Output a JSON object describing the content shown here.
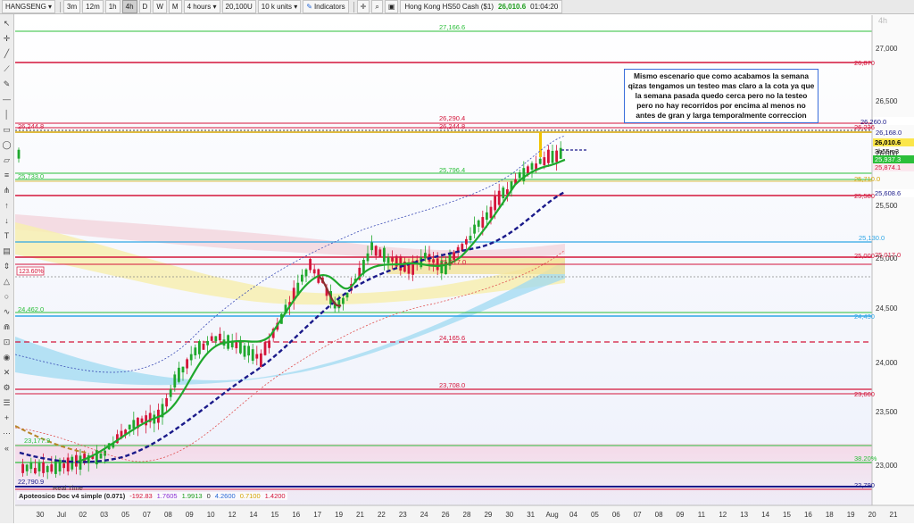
{
  "toolbar": {
    "symbol": "HANGSENG",
    "timeframes": [
      "3m",
      "12m",
      "1h",
      "4h",
      "D",
      "W",
      "M"
    ],
    "active_timeframe": "4h",
    "period": "4 hours",
    "units": "20,100U",
    "size": "10 k units",
    "indicators_label": "Indicators",
    "instrument_name": "Hong Kong HS50 Cash ($1)",
    "instrument_price": "26,010.6",
    "instrument_time": "01:04:20"
  },
  "chart": {
    "timeframe_mark": "4h",
    "y_axis_labels": [
      "27,000",
      "26,500",
      "26,000",
      "25,500",
      "25,000",
      "24,500",
      "24,000",
      "23,500",
      "23,000"
    ],
    "x_axis_labels": [
      "30",
      "Jul",
      "02",
      "03",
      "05",
      "07",
      "08",
      "09",
      "10",
      "12",
      "14",
      "15",
      "16",
      "17",
      "19",
      "21",
      "22",
      "23",
      "24",
      "26",
      "28",
      "29",
      "30",
      "31",
      "Aug",
      "04",
      "05",
      "06",
      "07",
      "08",
      "09",
      "11",
      "12",
      "13",
      "14",
      "15",
      "16",
      "18",
      "19",
      "20",
      "21"
    ],
    "level_labels": {
      "l27166": "27,166.6",
      "l26870": "26,870",
      "l26290": "26,290.4",
      "l26260": "26,260.0",
      "l26244": "26,244.8",
      "l26236": "26,236",
      "l26168": "26,168.0",
      "l26010": "26,010.6",
      "countdown": "3h55m3",
      "l25937": "25,937.3",
      "l25874": "25,874.1",
      "l25796": "25,796.4",
      "l25733": "25,733.0",
      "l25710": "25,710.0",
      "l25608": "25,608.6",
      "l25580": "25,580",
      "l25130": "25,130.0",
      "l25017": "25,017.0",
      "l25000": "25,000",
      "fib": "123.60%",
      "l24462": "24,462.0",
      "l24430": "24,430",
      "l24165": "24,165.6",
      "l23708": "23,708.0",
      "l23660": "23,660",
      "l23177": "23,177.9",
      "fib38": "38.20%",
      "l22790": "22,790.9",
      "l22790r": "22,790"
    },
    "annotation": "Mismo escenario que como acabamos la semana qizas tengamos un testeo mas claro a la cota ya que la semana pasada quedo cerca pero no la testeo pero no hay recorridos por encima al menos no antes de gran y larga temporalmente correccion",
    "indicator_panel": {
      "name": "Apoteosico Doc v4 simple (0.071)",
      "realtime": "Real Time",
      "values": [
        "-192.83",
        "1.7605",
        "1.9913",
        "0",
        "4.2600",
        "0.7100",
        "1.4200"
      ]
    }
  }
}
